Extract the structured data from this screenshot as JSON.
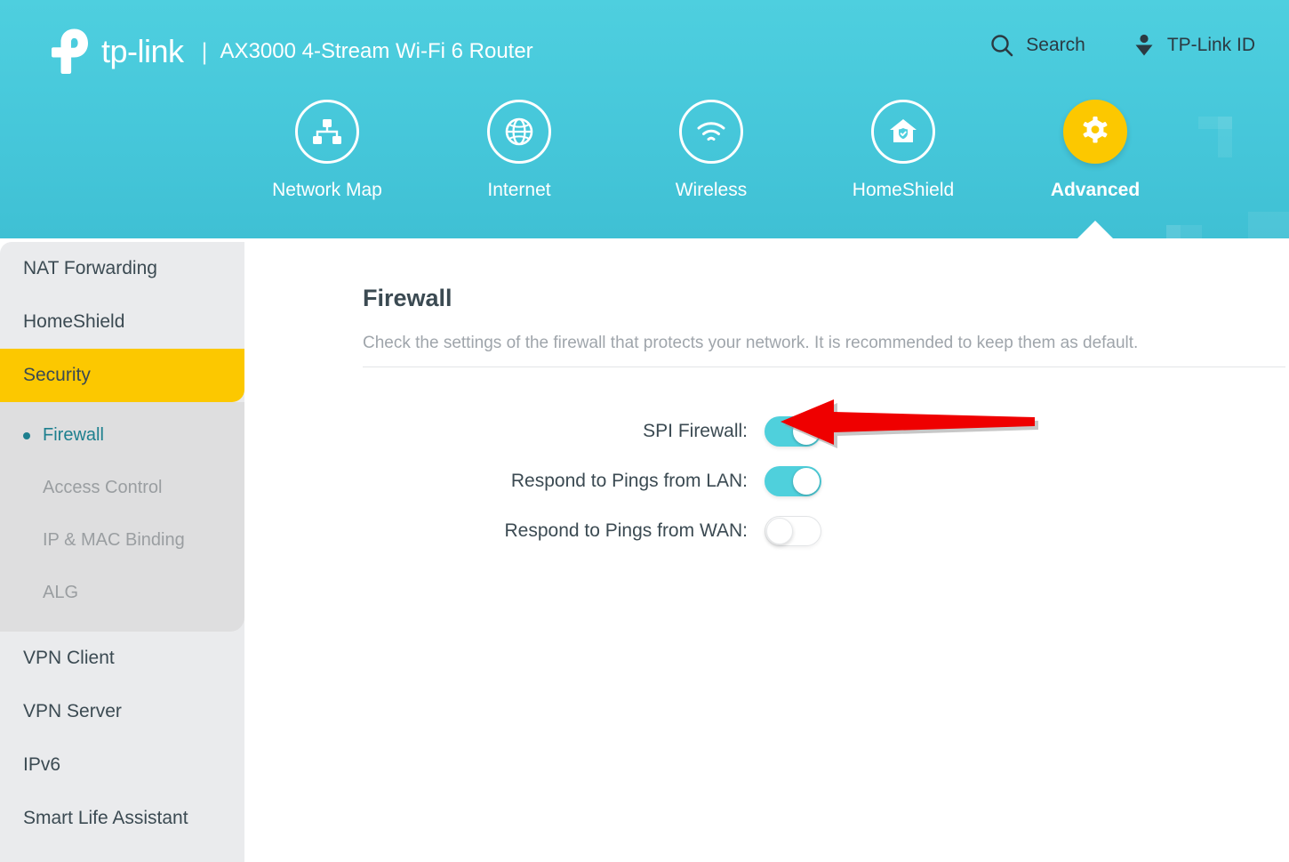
{
  "header": {
    "brand_word": "tp-link",
    "separator": "|",
    "model": "AX3000 4-Stream Wi-Fi 6 Router",
    "logo_icon": "tp-link-logo-icon",
    "actions": [
      {
        "label": "Search",
        "icon": "search-icon"
      },
      {
        "label": "TP-Link ID",
        "icon": "user-account-icon"
      }
    ],
    "tabs": [
      {
        "label": "Network Map",
        "icon": "network-topology-icon",
        "active": false
      },
      {
        "label": "Internet",
        "icon": "globe-icon",
        "active": false
      },
      {
        "label": "Wireless",
        "icon": "wifi-signal-icon",
        "active": false
      },
      {
        "label": "HomeShield",
        "icon": "home-shield-icon",
        "active": false
      },
      {
        "label": "Advanced",
        "icon": "gear-icon",
        "active": true
      }
    ]
  },
  "sidebar": {
    "items": [
      {
        "label": "NAT Forwarding",
        "selected": false
      },
      {
        "label": "HomeShield",
        "selected": false
      },
      {
        "label": "Security",
        "selected": true
      },
      {
        "label": "VPN Client",
        "selected": false
      },
      {
        "label": "VPN Server",
        "selected": false
      },
      {
        "label": "IPv6",
        "selected": false
      },
      {
        "label": "Smart Life Assistant",
        "selected": false
      }
    ],
    "submenu": [
      {
        "label": "Firewall",
        "active": true
      },
      {
        "label": "Access Control",
        "active": false
      },
      {
        "label": "IP & MAC Binding",
        "active": false
      },
      {
        "label": "ALG",
        "active": false
      }
    ]
  },
  "main": {
    "title": "Firewall",
    "description": "Check the settings of the firewall that protects your network. It is recommended to keep them as default.",
    "settings": [
      {
        "label": "SPI Firewall:",
        "state": "on"
      },
      {
        "label": "Respond to Pings from LAN:",
        "state": "on"
      },
      {
        "label": "Respond to Pings from WAN:",
        "state": "off"
      }
    ]
  },
  "annotation": {
    "type": "red-arrow-pointing-left",
    "color": "#ef0000",
    "target": "SPI Firewall toggle"
  },
  "colors": {
    "header_teal": "#46c7da",
    "accent_yellow": "#fcc800",
    "toggle_on": "#4fd0dc",
    "active_link_teal": "#1d7f8e",
    "sidebar_gray": "#eaebed",
    "submenu_gray": "#dededf"
  }
}
